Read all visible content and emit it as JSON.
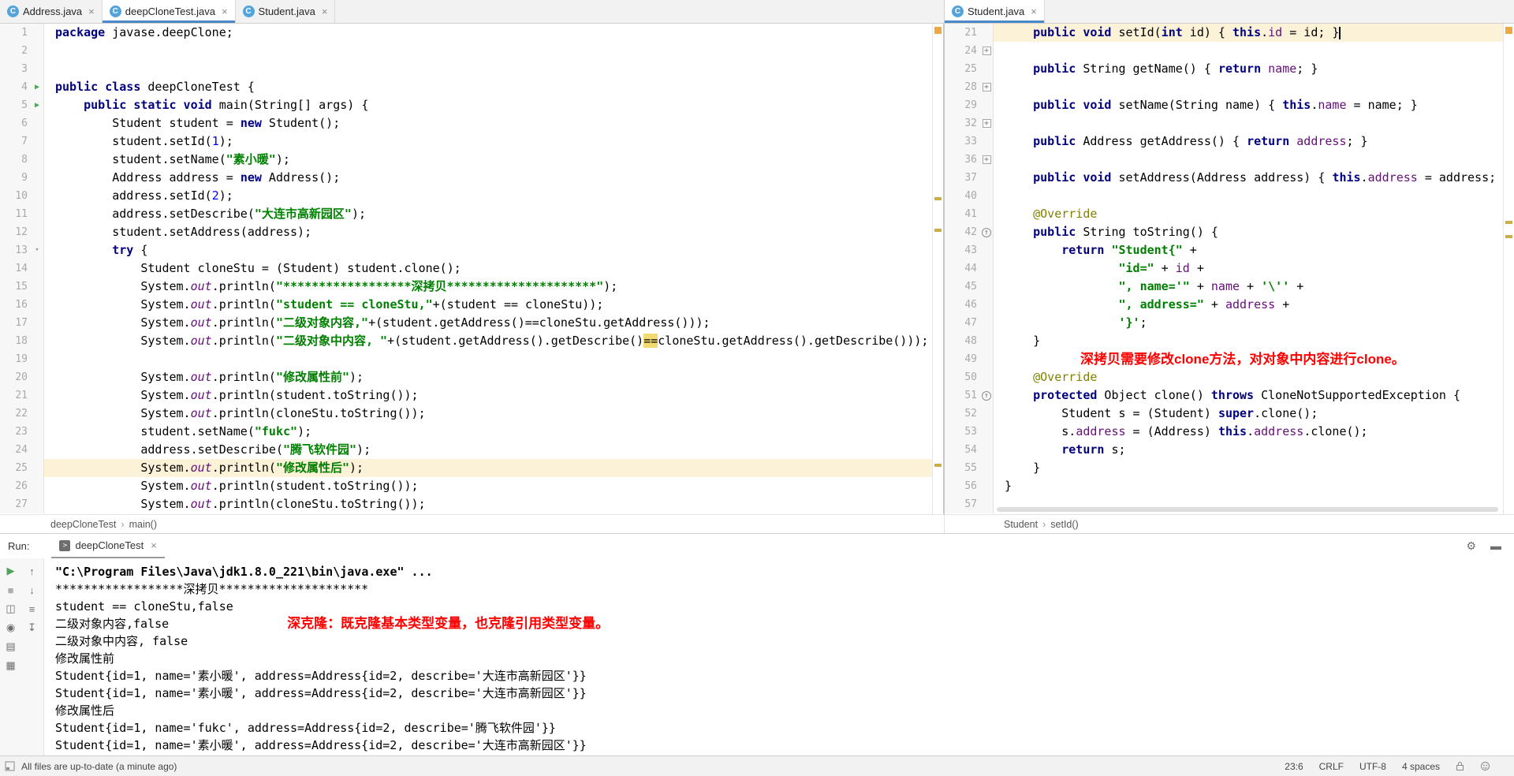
{
  "colors": {
    "keyword": "#000080",
    "string": "#008000",
    "number": "#0000FF",
    "field": "#660E7A",
    "annotation": "#808000",
    "caret_row": "#FBF2D7",
    "tab_underline": "#4A88C7",
    "run_arrow_green": "#4FA35C",
    "stripe_warning": "#CDAE44",
    "stripe_file_status": "#EFA941",
    "overlay_red": "#FF0000"
  },
  "window": {
    "tabs_left": [
      {
        "label": "Address.java",
        "active": false
      },
      {
        "label": "deepCloneTest.java",
        "active": true
      },
      {
        "label": "Student.java",
        "active": false
      }
    ],
    "tabs_right": [
      {
        "label": "Student.java",
        "active": true
      }
    ]
  },
  "left_editor": {
    "breadcrumb": [
      "deepCloneTest",
      "main()"
    ],
    "stripe_ticks": [
      220,
      260,
      558
    ],
    "lines": [
      {
        "n": 1,
        "s": [
          [
            "k",
            "package"
          ],
          [
            "p",
            " javase.deepClone;"
          ]
        ]
      },
      {
        "n": 2,
        "s": []
      },
      {
        "n": 3,
        "s": []
      },
      {
        "n": 4,
        "run": true,
        "s": [
          [
            "k",
            "public class"
          ],
          [
            "p",
            " deepCloneTest {"
          ]
        ]
      },
      {
        "n": 5,
        "run": true,
        "s": [
          [
            "p",
            "    "
          ],
          [
            "k",
            "public static void"
          ],
          [
            "p",
            " main(String[] args) {"
          ]
        ]
      },
      {
        "n": 6,
        "s": [
          [
            "p",
            "        Student student = "
          ],
          [
            "k",
            "new"
          ],
          [
            "p",
            " Student();"
          ]
        ]
      },
      {
        "n": 7,
        "s": [
          [
            "p",
            "        student.setId("
          ],
          [
            "d",
            "1"
          ],
          [
            "p",
            ");"
          ]
        ]
      },
      {
        "n": 8,
        "s": [
          [
            "p",
            "        student.setName("
          ],
          [
            "s",
            "\"素小暖\""
          ],
          [
            "p",
            ");"
          ]
        ]
      },
      {
        "n": 9,
        "s": [
          [
            "p",
            "        Address address = "
          ],
          [
            "k",
            "new"
          ],
          [
            "p",
            " Address();"
          ]
        ]
      },
      {
        "n": 10,
        "s": [
          [
            "p",
            "        address.setId("
          ],
          [
            "d",
            "2"
          ],
          [
            "p",
            ");"
          ]
        ]
      },
      {
        "n": 11,
        "s": [
          [
            "p",
            "        address.setDescribe("
          ],
          [
            "s",
            "\"大连市高新园区\""
          ],
          [
            "p",
            ");"
          ]
        ]
      },
      {
        "n": 12,
        "s": [
          [
            "p",
            "        student.setAddress(address);"
          ]
        ]
      },
      {
        "n": 13,
        "foldopen": true,
        "s": [
          [
            "p",
            "        "
          ],
          [
            "k",
            "try"
          ],
          [
            "p",
            " {"
          ]
        ]
      },
      {
        "n": 14,
        "s": [
          [
            "p",
            "            Student cloneStu = (Student) student.clone();"
          ]
        ]
      },
      {
        "n": 15,
        "s": [
          [
            "p",
            "            System."
          ],
          [
            "sf",
            "out"
          ],
          [
            "p",
            ".println("
          ],
          [
            "s",
            "\"******************深拷贝*********************\""
          ],
          [
            "p",
            ");"
          ]
        ]
      },
      {
        "n": 16,
        "s": [
          [
            "p",
            "            System."
          ],
          [
            "sf",
            "out"
          ],
          [
            "p",
            ".println("
          ],
          [
            "s",
            "\"student == cloneStu,\""
          ],
          [
            "p",
            "+(student == cloneStu));"
          ]
        ]
      },
      {
        "n": 17,
        "s": [
          [
            "p",
            "            System."
          ],
          [
            "sf",
            "out"
          ],
          [
            "p",
            ".println("
          ],
          [
            "s",
            "\"二级对象内容,\""
          ],
          [
            "p",
            "+(student.getAddress()==cloneStu.getAddress()));"
          ]
        ]
      },
      {
        "n": 18,
        "s": [
          [
            "p",
            "            System."
          ],
          [
            "sf",
            "out"
          ],
          [
            "p",
            ".println("
          ],
          [
            "s",
            "\"二级对象中内容, \""
          ],
          [
            "p",
            "+(student.getAddress().getDescribe()"
          ],
          [
            "hl",
            "=="
          ],
          [
            "p",
            "cloneStu.getAddress().getDescribe()));"
          ]
        ]
      },
      {
        "n": 19,
        "s": []
      },
      {
        "n": 20,
        "s": [
          [
            "p",
            "            System."
          ],
          [
            "sf",
            "out"
          ],
          [
            "p",
            ".println("
          ],
          [
            "s",
            "\"修改属性前\""
          ],
          [
            "p",
            ");"
          ]
        ]
      },
      {
        "n": 21,
        "s": [
          [
            "p",
            "            System."
          ],
          [
            "sf",
            "out"
          ],
          [
            "p",
            ".println(student.toString());"
          ]
        ]
      },
      {
        "n": 22,
        "s": [
          [
            "p",
            "            System."
          ],
          [
            "sf",
            "out"
          ],
          [
            "p",
            ".println(cloneStu.toString());"
          ]
        ]
      },
      {
        "n": 23,
        "s": [
          [
            "p",
            "            student.setName("
          ],
          [
            "s",
            "\"fukc\""
          ],
          [
            "p",
            ");"
          ]
        ]
      },
      {
        "n": 24,
        "s": [
          [
            "p",
            "            address.setDescribe("
          ],
          [
            "s",
            "\"腾飞软件园\""
          ],
          [
            "p",
            ");"
          ]
        ]
      },
      {
        "n": 25,
        "cur": true,
        "s": [
          [
            "p",
            "            System."
          ],
          [
            "sf",
            "out"
          ],
          [
            "p",
            ".println("
          ],
          [
            "s",
            "\"修改属性后\""
          ],
          [
            "p",
            ");"
          ]
        ]
      },
      {
        "n": 26,
        "s": [
          [
            "p",
            "            System."
          ],
          [
            "sf",
            "out"
          ],
          [
            "p",
            ".println(student.toString());"
          ]
        ]
      },
      {
        "n": 27,
        "s": [
          [
            "p",
            "            System."
          ],
          [
            "sf",
            "out"
          ],
          [
            "p",
            ".println(cloneStu.toString());"
          ]
        ]
      }
    ]
  },
  "right_editor": {
    "breadcrumb": [
      "Student",
      "setId()"
    ],
    "stripe_ticks": [
      250,
      268
    ],
    "lines": [
      {
        "n": 21,
        "cur": true,
        "caret": true,
        "s": [
          [
            "p",
            "    "
          ],
          [
            "k",
            "public void"
          ],
          [
            "p",
            " setId("
          ],
          [
            "k",
            "int"
          ],
          [
            "p",
            " id) { "
          ],
          [
            "k",
            "this"
          ],
          [
            "p",
            "."
          ],
          [
            "f",
            "id"
          ],
          [
            "p",
            " = id; }"
          ]
        ]
      },
      {
        "n": 24,
        "fold": true,
        "s": []
      },
      {
        "n": 25,
        "s": [
          [
            "p",
            "    "
          ],
          [
            "k",
            "public"
          ],
          [
            "p",
            " String getName() { "
          ],
          [
            "k",
            "return"
          ],
          [
            "p",
            " "
          ],
          [
            "f",
            "name"
          ],
          [
            "p",
            "; }"
          ]
        ]
      },
      {
        "n": 28,
        "fold": true,
        "s": []
      },
      {
        "n": 29,
        "s": [
          [
            "p",
            "    "
          ],
          [
            "k",
            "public void"
          ],
          [
            "p",
            " setName(String name) { "
          ],
          [
            "k",
            "this"
          ],
          [
            "p",
            "."
          ],
          [
            "f",
            "name"
          ],
          [
            "p",
            " = name; }"
          ]
        ]
      },
      {
        "n": 32,
        "fold": true,
        "s": []
      },
      {
        "n": 33,
        "s": [
          [
            "p",
            "    "
          ],
          [
            "k",
            "public"
          ],
          [
            "p",
            " Address getAddress() { "
          ],
          [
            "k",
            "return"
          ],
          [
            "p",
            " "
          ],
          [
            "f",
            "address"
          ],
          [
            "p",
            "; }"
          ]
        ]
      },
      {
        "n": 36,
        "fold": true,
        "s": []
      },
      {
        "n": 37,
        "s": [
          [
            "p",
            "    "
          ],
          [
            "k",
            "public void"
          ],
          [
            "p",
            " setAddress(Address address) { "
          ],
          [
            "k",
            "this"
          ],
          [
            "p",
            "."
          ],
          [
            "f",
            "address"
          ],
          [
            "p",
            " = address; }"
          ]
        ]
      },
      {
        "n": 40,
        "s": []
      },
      {
        "n": 41,
        "s": [
          [
            "p",
            "    "
          ],
          [
            "a",
            "@Override"
          ]
        ]
      },
      {
        "n": 42,
        "ovr": true,
        "s": [
          [
            "p",
            "    "
          ],
          [
            "k",
            "public"
          ],
          [
            "p",
            " String toString() {"
          ]
        ]
      },
      {
        "n": 43,
        "s": [
          [
            "p",
            "        "
          ],
          [
            "k",
            "return"
          ],
          [
            "p",
            " "
          ],
          [
            "s",
            "\"Student{\""
          ],
          [
            "p",
            " +"
          ]
        ]
      },
      {
        "n": 44,
        "s": [
          [
            "p",
            "                "
          ],
          [
            "s",
            "\"id=\""
          ],
          [
            "p",
            " + "
          ],
          [
            "f",
            "id"
          ],
          [
            "p",
            " +"
          ]
        ]
      },
      {
        "n": 45,
        "s": [
          [
            "p",
            "                "
          ],
          [
            "s",
            "\", name='\""
          ],
          [
            "p",
            " + "
          ],
          [
            "f",
            "name"
          ],
          [
            "p",
            " + "
          ],
          [
            "s",
            "'\\''"
          ],
          [
            "p",
            " +"
          ]
        ]
      },
      {
        "n": 46,
        "s": [
          [
            "p",
            "                "
          ],
          [
            "s",
            "\", address=\""
          ],
          [
            "p",
            " + "
          ],
          [
            "f",
            "address"
          ],
          [
            "p",
            " +"
          ]
        ]
      },
      {
        "n": 47,
        "s": [
          [
            "p",
            "                "
          ],
          [
            "s",
            "'}'"
          ],
          [
            "p",
            ";"
          ]
        ]
      },
      {
        "n": 48,
        "s": [
          [
            "p",
            "    }"
          ]
        ]
      },
      {
        "n": 49,
        "red": "深拷贝需要修改clone方法，对对象中内容进行clone。",
        "s": []
      },
      {
        "n": 50,
        "s": [
          [
            "p",
            "    "
          ],
          [
            "a",
            "@Override"
          ]
        ]
      },
      {
        "n": 51,
        "ovr": true,
        "s": [
          [
            "p",
            "    "
          ],
          [
            "k",
            "protected"
          ],
          [
            "p",
            " Object clone() "
          ],
          [
            "k",
            "throws"
          ],
          [
            "p",
            " CloneNotSupportedException {"
          ]
        ]
      },
      {
        "n": 52,
        "s": [
          [
            "p",
            "        Student s = (Student) "
          ],
          [
            "k",
            "super"
          ],
          [
            "p",
            ".clone();"
          ]
        ]
      },
      {
        "n": 53,
        "s": [
          [
            "p",
            "        s."
          ],
          [
            "f",
            "address"
          ],
          [
            "p",
            " = (Address) "
          ],
          [
            "k",
            "this"
          ],
          [
            "p",
            "."
          ],
          [
            "f",
            "address"
          ],
          [
            "p",
            ".clone();"
          ]
        ]
      },
      {
        "n": 54,
        "s": [
          [
            "p",
            "        "
          ],
          [
            "k",
            "return"
          ],
          [
            "p",
            " s;"
          ]
        ]
      },
      {
        "n": 55,
        "s": [
          [
            "p",
            "    }"
          ]
        ]
      },
      {
        "n": 56,
        "s": [
          [
            "p",
            "}"
          ]
        ]
      },
      {
        "n": 57,
        "s": []
      }
    ]
  },
  "run_panel": {
    "label": "Run:",
    "tab_label": "deepCloneTest",
    "header_icons": [
      {
        "name": "settings-icon",
        "glyph": "⚙"
      },
      {
        "name": "hide-panel-icon",
        "glyph": "▬"
      }
    ],
    "toolbar_columns": [
      [
        {
          "name": "rerun-button",
          "glyph": "▶",
          "color": "#4FA35C"
        },
        {
          "name": "stop-button",
          "glyph": "■",
          "color": "#ADADAD"
        },
        {
          "name": "restore-layout-button",
          "glyph": "◫",
          "color": "#6E6E6E"
        },
        {
          "name": "pin-tab-button",
          "glyph": "◉",
          "color": "#6E6E6E"
        },
        {
          "name": "print-button",
          "glyph": "▤",
          "color": "#6E6E6E"
        },
        {
          "name": "clear-all-button",
          "glyph": "▦",
          "color": "#6E6E6E"
        }
      ],
      [
        {
          "name": "up-stack-trace-button",
          "glyph": "↑",
          "color": "#6E6E6E"
        },
        {
          "name": "down-stack-trace-button",
          "glyph": "↓",
          "color": "#6E6E6E"
        },
        {
          "name": "soft-wraps-button",
          "glyph": "≡",
          "color": "#6E6E6E"
        },
        {
          "name": "scroll-to-end-button",
          "glyph": "↧",
          "color": "#6E6E6E"
        }
      ]
    ],
    "console": [
      {
        "t": "\"C:\\Program Files\\Java\\jdk1.8.0_221\\bin\\java.exe\" ...",
        "b": true
      },
      {
        "t": "******************深拷贝*********************"
      },
      {
        "t": "student == cloneStu,false"
      },
      {
        "t": "二级对象内容,false",
        "ann": "深克隆：既克隆基本类型变量，也克隆引用类型变量。"
      },
      {
        "t": "二级对象中内容, false"
      },
      {
        "t": "修改属性前"
      },
      {
        "t": "Student{id=1, name='素小暖', address=Address{id=2, describe='大连市高新园区'}}"
      },
      {
        "t": "Student{id=1, name='素小暖', address=Address{id=2, describe='大连市高新园区'}}"
      },
      {
        "t": "修改属性后"
      },
      {
        "t": "Student{id=1, name='fukc', address=Address{id=2, describe='腾飞软件园'}}"
      },
      {
        "t": "Student{id=1, name='素小暖', address=Address{id=2, describe='大连市高新园区'}}"
      }
    ]
  },
  "status_bar": {
    "left_text": "All files are up-to-date (a minute ago)",
    "items": [
      {
        "name": "caret-position-indicator",
        "text": "23:6"
      },
      {
        "name": "line-separator-indicator",
        "text": "CRLF"
      },
      {
        "name": "encoding-indicator",
        "text": "UTF-8"
      },
      {
        "name": "indent-indicator",
        "text": "4 spaces"
      }
    ]
  }
}
